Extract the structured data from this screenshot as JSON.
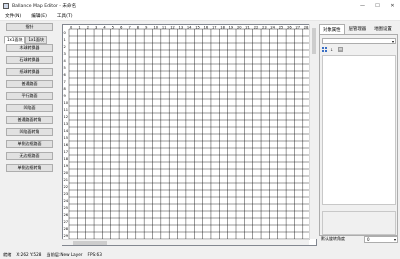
{
  "window": {
    "title": "Ballance Map Editor - 未命名",
    "minimize": "—",
    "maximize": "☐",
    "close": "✕"
  },
  "menu": [
    {
      "label": "文件(N)"
    },
    {
      "label": "编辑(E)"
    },
    {
      "label": "工具(T)"
    }
  ],
  "left_tools": {
    "top_button": "指针",
    "tabs": [
      "1x1面块",
      "1x1面块"
    ],
    "buttons": [
      "木球转换器",
      "石球转换器",
      "纸球转换器",
      "普通路面",
      "平行路面",
      "凹陷面",
      "普通路面转角",
      "凹陷面转角",
      "单侧边框路面",
      "无边框路面",
      "单侧边框转角"
    ]
  },
  "grid": {
    "col_labels": [
      "0",
      "1",
      "2",
      "3",
      "4",
      "5",
      "6",
      "7",
      "8",
      "9",
      "10",
      "11",
      "12",
      "13",
      "14",
      "15",
      "16",
      "17",
      "18",
      "19",
      "20",
      "21",
      "22",
      "23",
      "24",
      "25",
      "26",
      "27",
      "28"
    ],
    "row_labels": [
      "0",
      "1",
      "2",
      "3",
      "4",
      "5",
      "6",
      "7",
      "8",
      "9",
      "10",
      "11",
      "12",
      "13",
      "14",
      "15",
      "16",
      "17",
      "18",
      "19",
      "20",
      "21",
      "22",
      "23",
      "24",
      "25",
      "26",
      "27",
      "28",
      "29",
      "30"
    ]
  },
  "right_panel": {
    "tabs": [
      "对象属性",
      "层管理器",
      "地图设置"
    ],
    "rotation_label": "默认旋转角度",
    "rotation_value": "0",
    "tool_icons": [
      "sort-category-icon",
      "sort-alphabetical-icon",
      "property-pages-icon"
    ]
  },
  "status": {
    "state": "就绪",
    "coords": "X:262 Y:528",
    "layer": "当前层:New Layer",
    "fps": "FPS:63"
  }
}
